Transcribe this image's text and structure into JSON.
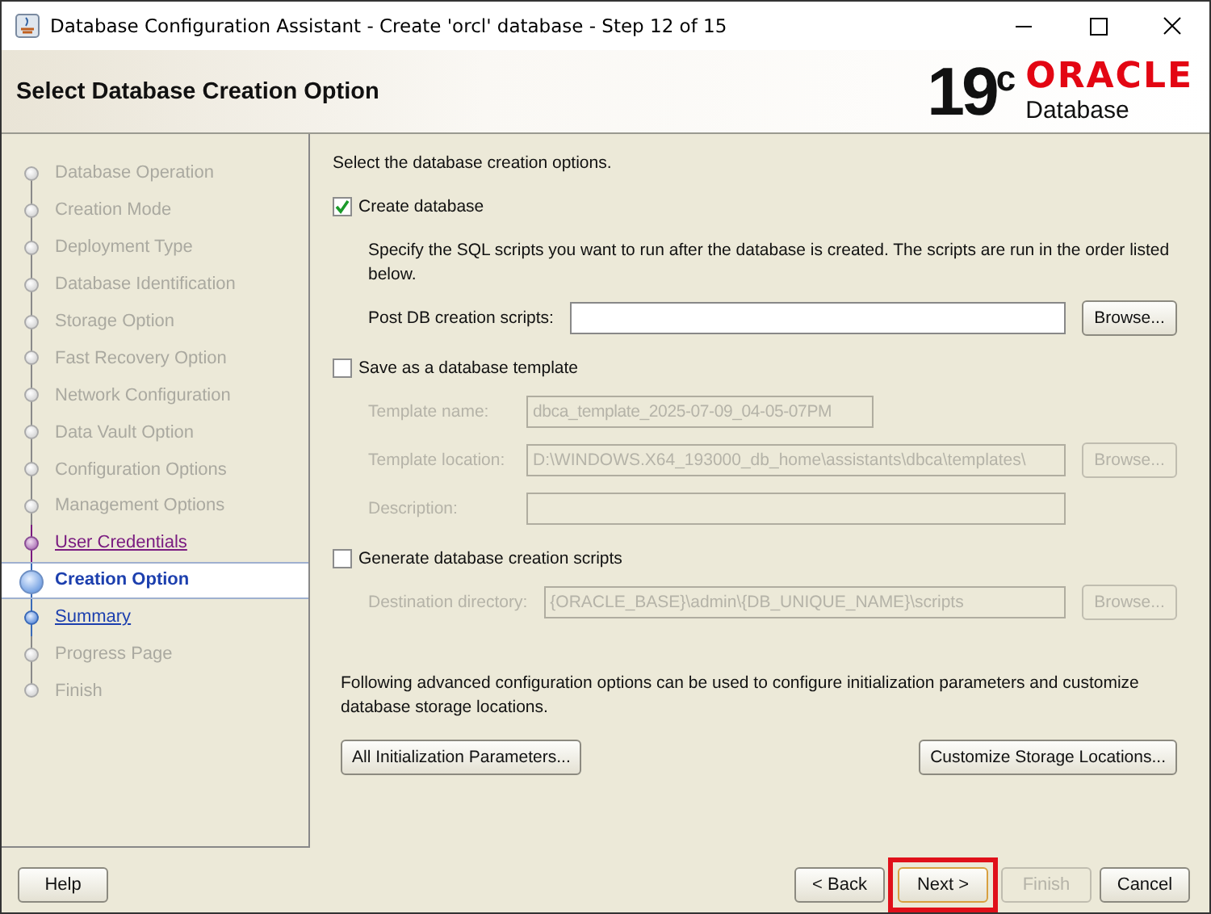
{
  "window": {
    "title": "Database Configuration Assistant - Create 'orcl' database - Step 12 of 15"
  },
  "header": {
    "title": "Select Database Creation Option",
    "logo": {
      "version": "19$^{c}$",
      "brand": "ORACLE",
      "product": "Database"
    }
  },
  "steps": [
    {
      "label": "Database Operation",
      "disabled": true,
      "visited": false,
      "selected": false
    },
    {
      "label": "Creation Mode",
      "disabled": true,
      "visited": false,
      "selected": false
    },
    {
      "label": "Deployment Type",
      "disabled": true,
      "visited": false,
      "selected": false
    },
    {
      "label": "Database Identification",
      "disabled": true,
      "visited": false,
      "selected": false
    },
    {
      "label": "Storage Option",
      "disabled": true,
      "visited": false,
      "selected": false
    },
    {
      "label": "Fast Recovery Option",
      "disabled": true,
      "visited": false,
      "selected": false
    },
    {
      "label": "Network Configuration",
      "disabled": true,
      "visited": false,
      "selected": false
    },
    {
      "label": "Data Vault Option",
      "disabled": true,
      "visited": false,
      "selected": false
    },
    {
      "label": "Configuration Options",
      "disabled": true,
      "visited": false,
      "selected": false
    },
    {
      "label": "Management Options",
      "disabled": true,
      "visited": false,
      "selected": false
    },
    {
      "label": "User Credentials",
      "disabled": false,
      "visited": true,
      "selected": false
    },
    {
      "label": "Creation Option",
      "disabled": false,
      "visited": false,
      "selected": true
    },
    {
      "label": "Summary",
      "disabled": false,
      "visited": false,
      "selected": false
    },
    {
      "label": "Progress Page",
      "disabled": true,
      "visited": false,
      "selected": false
    },
    {
      "label": "Finish",
      "disabled": true,
      "visited": false,
      "selected": false
    }
  ],
  "content": {
    "intro": "Select the database creation options.",
    "sections": [
      {
        "label": "Create database",
        "checked": true,
        "description": "Specify the SQL scripts you want to run after the database is created. The scripts are run in the order listed below.",
        "fields": [
          {
            "label": "Post DB creation scripts:",
            "kind": "wide",
            "disabled": false,
            "button": "Browse..."
          }
        ]
      },
      {
        "label": "Save as a database template",
        "checked": false,
        "fields": [
          {
            "label": "Template name:",
            "kind": "short",
            "disabled": true,
            "value": "dbca_template_2025-07-09_04-05-07PM"
          },
          {
            "label": "Template location:",
            "kind": "wide",
            "disabled": true,
            "value": "D:\\WINDOWS.X64_193000_db_home\\assistants\\dbca\\templates\\",
            "button": "Browse..."
          },
          {
            "label": "Description:",
            "kind": "wide",
            "disabled": true
          }
        ]
      },
      {
        "label": "Generate database creation scripts",
        "checked": false,
        "fields": [
          {
            "label": "Destination directory:",
            "kind": "wide",
            "disabled": true,
            "value": "{ORACLE_BASE}\\admin\\{DB_UNIQUE_NAME}\\scripts",
            "button": "Browse..."
          }
        ]
      }
    ],
    "advanced": {
      "text": "Following advanced configuration options can be used to configure initialization parameters and customize database storage locations.",
      "buttons": [
        "All Initialization Parameters...",
        "Customize Storage Locations..."
      ]
    }
  },
  "footer": {
    "help": "Help",
    "buttons": [
      {
        "label": "< Back",
        "disabled": false,
        "highlighted": false
      },
      {
        "label": "Next >",
        "disabled": false,
        "highlighted": true
      },
      {
        "label": "Finish",
        "disabled": true,
        "highlighted": false
      },
      {
        "label": "Cancel",
        "disabled": false,
        "highlighted": false
      }
    ]
  }
}
